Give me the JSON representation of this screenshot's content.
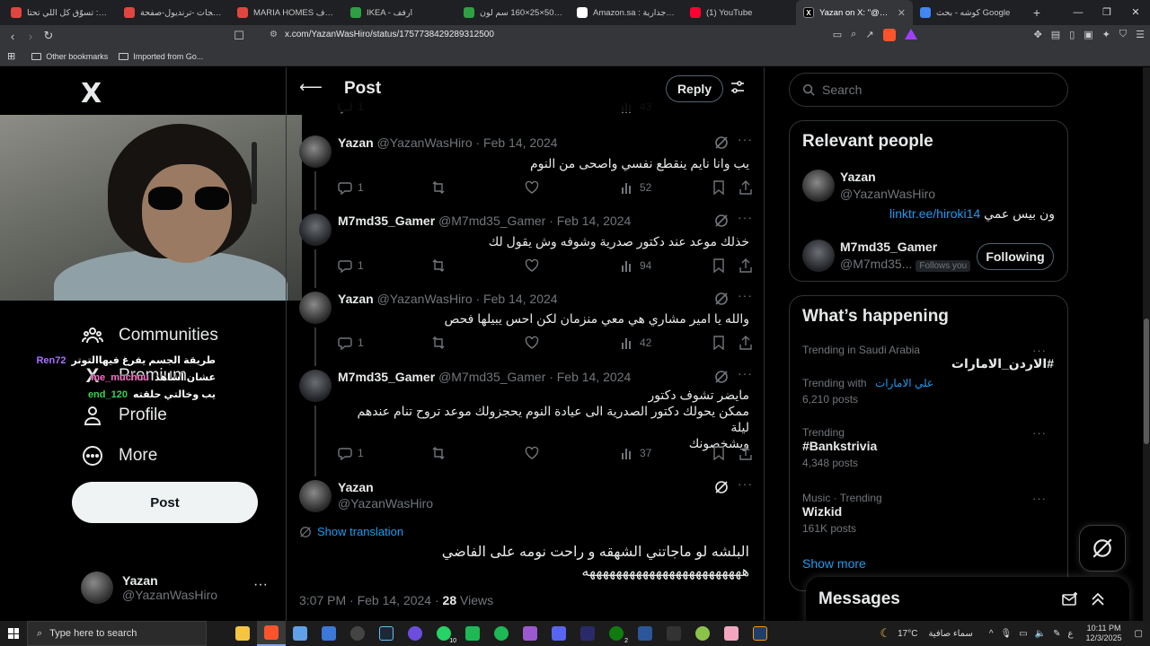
{
  "browser": {
    "tabs": [
      {
        "title": "ترنديول: تسوّق كل اللي تحتا...",
        "icon_color": "#e0463f",
        "active": false
      },
      {
        "title": "كل منتجات -ترنديول-صفحة...",
        "icon_color": "#e0463f",
        "active": false
      },
      {
        "title": "MARIA HOMES شكل حرف",
        "icon_color": "#e0463f",
        "active": false
      },
      {
        "title": "IKEA - ارفف",
        "icon_color": "#2ea043",
        "active": false
      },
      {
        "title": "مكتبة 50×25×160 سم لون",
        "icon_color": "#2ea043",
        "active": false
      },
      {
        "title": "Amazon.sa : رفوف جدارية",
        "icon_color": "#ffffff",
        "active": false
      },
      {
        "title": "(1) YouTube",
        "icon_color": "#ff0033",
        "active": false
      },
      {
        "title": "Yazan on X: \"@M7md",
        "icon_color": "#000000",
        "active": true
      },
      {
        "title": "كوشه - بحث Google",
        "icon_color": "#4285f4",
        "active": false
      }
    ],
    "new_tab_label": "+",
    "url": "x.com/YazanWasHiro/status/1757738429289312500",
    "bookmarks": [
      {
        "label": "Other bookmarks"
      },
      {
        "label": "Imported from Go..."
      }
    ]
  },
  "left_nav": {
    "logo": "X",
    "items": [
      {
        "label": "Communities",
        "icon": "communities-icon"
      },
      {
        "label": "Premium",
        "icon": "x-premium-icon"
      },
      {
        "label": "Profile",
        "icon": "profile-icon"
      },
      {
        "label": "More",
        "icon": "more-circle-icon"
      }
    ],
    "post_button": "Post",
    "account": {
      "name": "Yazan",
      "handle": "@YazanWasHiro",
      "more": "···"
    }
  },
  "stream_chat": [
    {
      "user": "Ren72",
      "color": "#a970ff",
      "message": "طريقة الجسم يفرغ فيهاالتوتر"
    },
    {
      "user": "me_muchuu",
      "color": "#ff6ec7",
      "message": "عشان اشاهد"
    },
    {
      "user": "end_120",
      "color": "#39d353",
      "message": "يب وخالتي حلقته"
    }
  ],
  "center": {
    "title": "Post",
    "reply_button": "Reply",
    "prev_actions": {
      "replies": "1",
      "views": "43"
    },
    "tweets": [
      {
        "name": "Yazan",
        "handle": "@YazanWasHiro · Feb 14, 2024",
        "lines": [
          "يب وانا نايم ينقطع نفسي واصحى من النوم"
        ],
        "replies": "1",
        "views": "52"
      },
      {
        "name": "M7md35_Gamer",
        "handle": "@M7md35_Gamer · Feb 14, 2024",
        "lines": [
          "خذلك موعد عند دكتور صدرية وشوفه وش يقول لك"
        ],
        "replies": "1",
        "views": "94"
      },
      {
        "name": "Yazan",
        "handle": "@YazanWasHiro · Feb 14, 2024",
        "lines": [
          "والله يا امير مشاري هي معي منزمان لكن احس يبيلها فحص"
        ],
        "replies": "1",
        "views": "42"
      },
      {
        "name": "M7md35_Gamer",
        "handle": "@M7md35_Gamer · Feb 14, 2024",
        "lines": [
          "مايضر تشوف دكتور",
          "ممكن يحولك دكتور الصدرية الى عيادة النوم يحجزولك موعد تروح تنام عندهم ليلة",
          "ويشخصونك"
        ],
        "replies": "1",
        "views": "37"
      }
    ],
    "main_post": {
      "name": "Yazan",
      "handle": "@YazanWasHiro",
      "show_translation": "Show translation",
      "lines": [
        "البلشه لو ماجاتني الشهقه و راحت نومه على الفاضي",
        "ههههههههههههههههههههههههه"
      ],
      "time": "3:07 PM · Feb 14, 2024 · ",
      "views": "28",
      "views_label": " Views"
    }
  },
  "right": {
    "search_placeholder": "Search",
    "relevant_people": {
      "title": "Relevant people",
      "people": [
        {
          "name": "Yazan",
          "handle": "@YazanWasHiro",
          "bio_text": "ون بيس عمي ",
          "bio_link": "linktr.ee/hiroki14"
        },
        {
          "name": "M7md35_Gamer",
          "handle": "@M7md35...",
          "follows_you": "Follows you",
          "button": "Following"
        }
      ]
    },
    "whats_happening": {
      "title": "What’s happening",
      "trends": [
        {
          "context": "Trending in Saudi Arabia",
          "name": "#الاردن_الامارات",
          "with_label": "Trending with",
          "with_tag": "علي الامارات",
          "posts": "6,210 posts"
        },
        {
          "context": "Trending",
          "name": "#Bankstrivia",
          "posts": "4,348 posts"
        },
        {
          "context": "Music · Trending",
          "name": "Wizkid",
          "posts": "161K posts"
        }
      ],
      "show_more": "Show more"
    },
    "messages": {
      "title": "Messages"
    }
  },
  "taskbar": {
    "search_placeholder": "Type here to search",
    "weather_temp": "17°C",
    "weather_desc": "سماء صافية",
    "lang": "ع",
    "time": "10:11 PM",
    "date": "12/3/2025",
    "badges": {
      "whatsapp": "10",
      "xbox": "2"
    }
  }
}
